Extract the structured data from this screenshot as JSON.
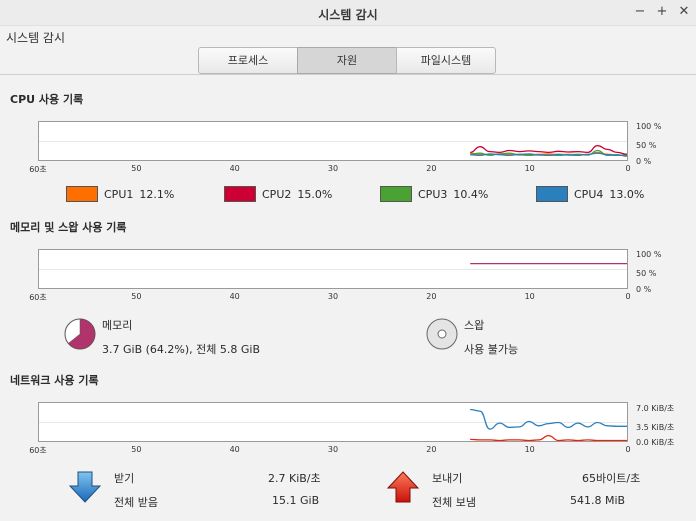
{
  "window": {
    "title": "시스템 감시",
    "minimize_label": "−",
    "maximize_label": "+",
    "close_label": "✕"
  },
  "app_menu": "시스템 감시",
  "tabs": [
    {
      "label": "프로세스",
      "active": false
    },
    {
      "label": "자원",
      "active": true
    },
    {
      "label": "파일시스템",
      "active": false
    }
  ],
  "cpu": {
    "title": "CPU 사용 기록",
    "y_ticks": [
      "100 %",
      "50 %",
      "0 %"
    ],
    "x_ticks": [
      "60초",
      "50",
      "40",
      "30",
      "20",
      "10",
      "0"
    ],
    "legend": [
      {
        "name": "CPU1",
        "value": "12.1%",
        "color": "#ff6f00"
      },
      {
        "name": "CPU2",
        "value": "15.0%",
        "color": "#cc0033"
      },
      {
        "name": "CPU3",
        "value": "10.4%",
        "color": "#4aa232"
      },
      {
        "name": "CPU4",
        "value": "13.0%",
        "color": "#2a7fbd"
      }
    ]
  },
  "memory": {
    "title": "메모리 및 스왑 사용 기록",
    "y_ticks": [
      "100 %",
      "50 %",
      "0 %"
    ],
    "x_ticks": [
      "60초",
      "50",
      "40",
      "30",
      "20",
      "10",
      "0"
    ],
    "mem_label": "메모리",
    "mem_value": "3.7 GiB (64.2%), 전체 5.8 GiB",
    "mem_color": "#b0336b",
    "mem_percent": 64.2,
    "swap_label": "스왑",
    "swap_value": "사용 불가능"
  },
  "network": {
    "title": "네트워크 사용 기록",
    "y_ticks": [
      "7.0 KiB/초",
      "3.5 KiB/초",
      "0.0 KiB/초"
    ],
    "x_ticks": [
      "60초",
      "50",
      "40",
      "30",
      "20",
      "10",
      "0"
    ],
    "recv_label": "받기",
    "recv_rate": "2.7 KiB/초",
    "recv_total_label": "전체 받음",
    "recv_total": "15.1 GiB",
    "send_label": "보내기",
    "send_rate": "65바이트/초",
    "send_total_label": "전체 보냄",
    "send_total": "541.8 MiB",
    "recv_color": "#2a7fbd",
    "send_color": "#e8240c"
  },
  "chart_data": [
    {
      "type": "line",
      "x": [
        16,
        15,
        14,
        13,
        12,
        11,
        10,
        9,
        8,
        7,
        6,
        5,
        4,
        3,
        2,
        1,
        0
      ],
      "series": [
        {
          "name": "CPU1",
          "values": [
            18,
            15,
            14,
            16,
            15,
            13,
            14,
            15,
            16,
            14,
            15,
            13,
            14,
            20,
            15,
            13,
            12
          ]
        },
        {
          "name": "CPU2",
          "values": [
            20,
            35,
            22,
            20,
            25,
            22,
            24,
            22,
            20,
            23,
            21,
            22,
            20,
            38,
            28,
            20,
            15
          ]
        },
        {
          "name": "CPU3",
          "values": [
            15,
            18,
            12,
            16,
            18,
            14,
            12,
            14,
            13,
            12,
            14,
            15,
            13,
            25,
            12,
            14,
            10
          ]
        },
        {
          "name": "CPU4",
          "values": [
            14,
            12,
            16,
            14,
            12,
            15,
            16,
            13,
            12,
            15,
            13,
            12,
            15,
            18,
            14,
            12,
            13
          ]
        }
      ],
      "xlim": [
        60,
        0
      ],
      "ylim": [
        0,
        100
      ]
    },
    {
      "type": "line",
      "x": [
        16,
        0
      ],
      "series": [
        {
          "name": "메모리",
          "values": [
            64.2,
            64.2
          ]
        }
      ],
      "xlim": [
        60,
        0
      ],
      "ylim": [
        0,
        100
      ]
    },
    {
      "type": "line",
      "x": [
        16,
        15,
        14,
        13,
        12,
        11,
        10,
        9,
        8,
        7,
        6,
        5,
        4,
        3,
        2,
        1,
        0
      ],
      "series": [
        {
          "name": "받기",
          "values": [
            5.8,
            5.5,
            2.2,
            3.3,
            2.5,
            2.6,
            3.6,
            2.8,
            3.2,
            3.4,
            2.5,
            3.3,
            2.6,
            3.4,
            2.8,
            2.7,
            2.7
          ]
        },
        {
          "name": "보내기",
          "values": [
            0.3,
            0.2,
            0.2,
            0.1,
            0.2,
            0.2,
            0.1,
            0.2,
            1.0,
            0.1,
            0.2,
            0.1,
            0.2,
            0.1,
            0.1,
            0.1,
            0.1
          ]
        }
      ],
      "xlim": [
        60,
        0
      ],
      "ylim": [
        0,
        7.0
      ]
    }
  ]
}
